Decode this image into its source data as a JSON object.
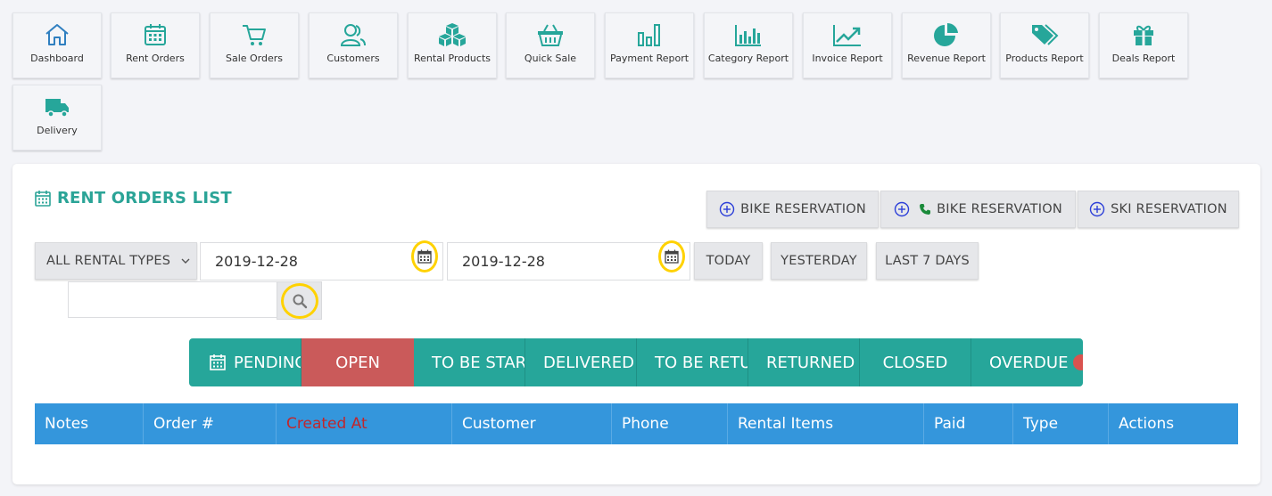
{
  "nav": {
    "items": [
      {
        "label": "Dashboard",
        "icon": "home-icon"
      },
      {
        "label": "Rent Orders",
        "icon": "calendar-icon"
      },
      {
        "label": "Sale Orders",
        "icon": "cart-icon"
      },
      {
        "label": "Customers",
        "icon": "users-icon"
      },
      {
        "label": "Rental Products",
        "icon": "cubes-icon"
      },
      {
        "label": "Quick Sale",
        "icon": "basket-icon"
      },
      {
        "label": "Payment Report",
        "icon": "bar-chart-icon"
      },
      {
        "label": "Category Report",
        "icon": "column-chart-icon"
      },
      {
        "label": "Invoice Report",
        "icon": "line-chart-icon"
      },
      {
        "label": "Revenue Report",
        "icon": "pie-chart-icon"
      },
      {
        "label": "Products Report",
        "icon": "tags-icon"
      },
      {
        "label": "Deals Report",
        "icon": "gift-icon"
      },
      {
        "label": "Delivery",
        "icon": "truck-icon"
      }
    ]
  },
  "panel": {
    "title": "RENT ORDERS LIST",
    "reservations": [
      {
        "label": "BIKE RESERVATION"
      },
      {
        "label": "BIKE RESERVATION"
      },
      {
        "label": "SKI RESERVATION"
      }
    ]
  },
  "filters": {
    "rental_type": "ALL RENTAL TYPES",
    "date_from": "2019-12-28",
    "date_to": "2019-12-28",
    "quick": [
      "TODAY",
      "YESTERDAY",
      "LAST 7 DAYS"
    ],
    "search_value": ""
  },
  "tabs": [
    "PENDING",
    "OPEN",
    "TO BE STARTED",
    "DELIVERED",
    "TO BE RETURNED",
    "RETURNED",
    "CLOSED",
    "OVERDUE"
  ],
  "table": {
    "columns": [
      "Notes",
      "Order #",
      "Created At",
      "Customer",
      "Phone",
      "Rental Items",
      "Paid",
      "Type",
      "Actions"
    ]
  },
  "colors": {
    "accent": "#26a69a",
    "active_tab": "#ca5a5a",
    "table_header": "#3496dc",
    "highlight": "#ffd200"
  }
}
